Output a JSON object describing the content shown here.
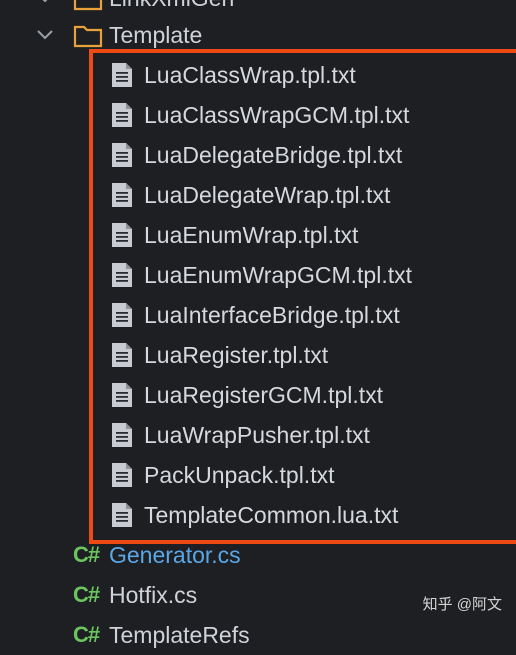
{
  "tree": {
    "top_partial_label": "LinkXmlGen",
    "folder": {
      "label": "Template",
      "expanded": true
    },
    "files": [
      "LuaClassWrap.tpl.txt",
      "LuaClassWrapGCM.tpl.txt",
      "LuaDelegateBridge.tpl.txt",
      "LuaDelegateWrap.tpl.txt",
      "LuaEnumWrap.tpl.txt",
      "LuaEnumWrapGCM.tpl.txt",
      "LuaInterfaceBridge.tpl.txt",
      "LuaRegister.tpl.txt",
      "LuaRegisterGCM.tpl.txt",
      "LuaWrapPusher.tpl.txt",
      "PackUnpack.tpl.txt",
      "TemplateCommon.lua.txt"
    ],
    "cs_files": [
      {
        "badge": "C#",
        "label": "Generator.cs",
        "selected_color": "#5aa7e8"
      },
      {
        "badge": "C#",
        "label": "Hotfix.cs",
        "selected_color": "#d5d8dd"
      },
      {
        "badge": "C#",
        "label": "TemplateRefs",
        "selected_color": "#d5d8dd"
      }
    ]
  },
  "colors": {
    "background": "#1e1f22",
    "highlight": "#f04a14",
    "folder_orange": "#e9a23b",
    "cs_green": "#6cc45f"
  },
  "watermark": "知乎 @阿文"
}
